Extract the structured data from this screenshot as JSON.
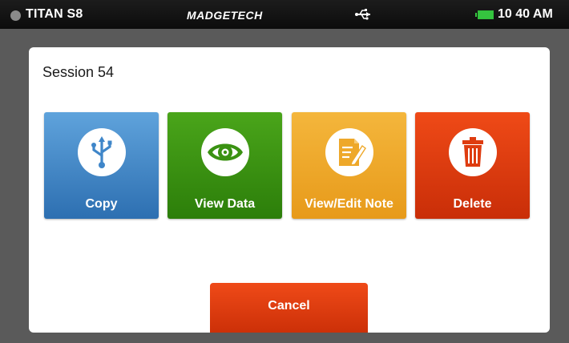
{
  "status_bar": {
    "device_name": "TITAN S8",
    "brand": "MADGETECH",
    "time": "10 40 AM",
    "icons": [
      "status-dot-icon",
      "usb-icon",
      "battery-icon"
    ]
  },
  "dialog": {
    "title": "Session 54",
    "actions": [
      {
        "label": "Copy",
        "icon": "usb-icon",
        "color": "#3f86c9"
      },
      {
        "label": "View Data",
        "icon": "eye-icon",
        "color": "#3a9212"
      },
      {
        "label": "View/Edit Note",
        "icon": "note-edit-icon",
        "color": "#eea82a"
      },
      {
        "label": "Delete",
        "icon": "trash-icon",
        "color": "#de3c10"
      }
    ],
    "cancel_label": "Cancel"
  },
  "colors": {
    "background": "#5a5a5a",
    "status_bar": "#111111",
    "battery": "#35c43f",
    "dialog": "#ffffff"
  }
}
